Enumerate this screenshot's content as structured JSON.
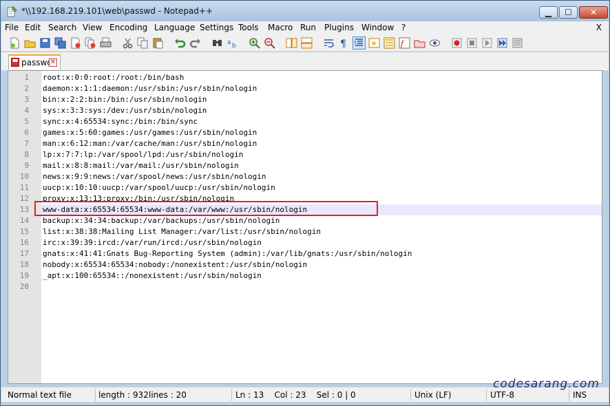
{
  "window": {
    "title": "*\\\\192.168.219.101\\web\\passwd - Notepad++",
    "buttons": {
      "minimize": "▁",
      "maximize": "☐",
      "close": "✕"
    }
  },
  "menubar": {
    "items": [
      "File",
      "Edit",
      "Search",
      "View",
      "Encoding",
      "Language",
      "Settings",
      "Tools",
      "Macro",
      "Run",
      "Plugins",
      "Window",
      "?"
    ],
    "close_glyph": "X"
  },
  "toolbar": {
    "icons": [
      "new-file-icon",
      "open-file-icon",
      "save-icon",
      "save-all-icon",
      "close-icon",
      "close-all-icon",
      "print-icon",
      "cut-icon",
      "copy-icon",
      "paste-icon",
      "undo-icon",
      "redo-icon",
      "find-icon",
      "replace-icon",
      "zoom-in-icon",
      "zoom-out-icon",
      "sync-vertical-icon",
      "sync-horizontal-icon",
      "word-wrap-icon",
      "show-all-chars-icon",
      "indent-guide-icon",
      "user-lang-icon",
      "doc-map-icon",
      "function-list-icon",
      "folder-workspace-icon",
      "monitor-icon",
      "record-macro-icon",
      "stop-macro-icon",
      "play-macro-icon",
      "run-multiple-macro-icon",
      "save-macro-icon"
    ]
  },
  "tab": {
    "label": "passwd",
    "close": "✕"
  },
  "editor": {
    "current_line": 13,
    "lines": [
      "root:x:0:0:root:/root:/bin/bash",
      "daemon:x:1:1:daemon:/usr/sbin:/usr/sbin/nologin",
      "bin:x:2:2:bin:/bin:/usr/sbin/nologin",
      "sys:x:3:3:sys:/dev:/usr/sbin/nologin",
      "sync:x:4:65534:sync:/bin:/bin/sync",
      "games:x:5:60:games:/usr/games:/usr/sbin/nologin",
      "man:x:6:12:man:/var/cache/man:/usr/sbin/nologin",
      "lp:x:7:7:lp:/var/spool/lpd:/usr/sbin/nologin",
      "mail:x:8:8:mail:/var/mail:/usr/sbin/nologin",
      "news:x:9:9:news:/var/spool/news:/usr/sbin/nologin",
      "uucp:x:10:10:uucp:/var/spool/uucp:/usr/sbin/nologin",
      "proxy:x:13:13:proxy:/bin:/usr/sbin/nologin",
      "www-data:x:65534:65534:www-data:/var/www:/usr/sbin/nologin",
      "backup:x:34:34:backup:/var/backups:/usr/sbin/nologin",
      "list:x:38:38:Mailing List Manager:/var/list:/usr/sbin/nologin",
      "irc:x:39:39:ircd:/var/run/ircd:/usr/sbin/nologin",
      "gnats:x:41:41:Gnats Bug-Reporting System (admin):/var/lib/gnats:/usr/sbin/nologin",
      "nobody:x:65534:65534:nobody:/nonexistent:/usr/sbin/nologin",
      "_apt:x:100:65534::/nonexistent:/usr/sbin/nologin",
      ""
    ]
  },
  "statusbar": {
    "file_type": "Normal text file",
    "length": "length : 932",
    "lines": "lines : 20",
    "position": "Ln : 13    Col : 23    Sel : 0 | 0",
    "eol": "Unix (LF)",
    "encoding": "UTF-8",
    "mode": "INS"
  },
  "watermark": "codesarang.com",
  "colors": {
    "highlight_box": "#e02020",
    "current_line": "#e8e8ff",
    "tab_accent": "#f6a623"
  }
}
